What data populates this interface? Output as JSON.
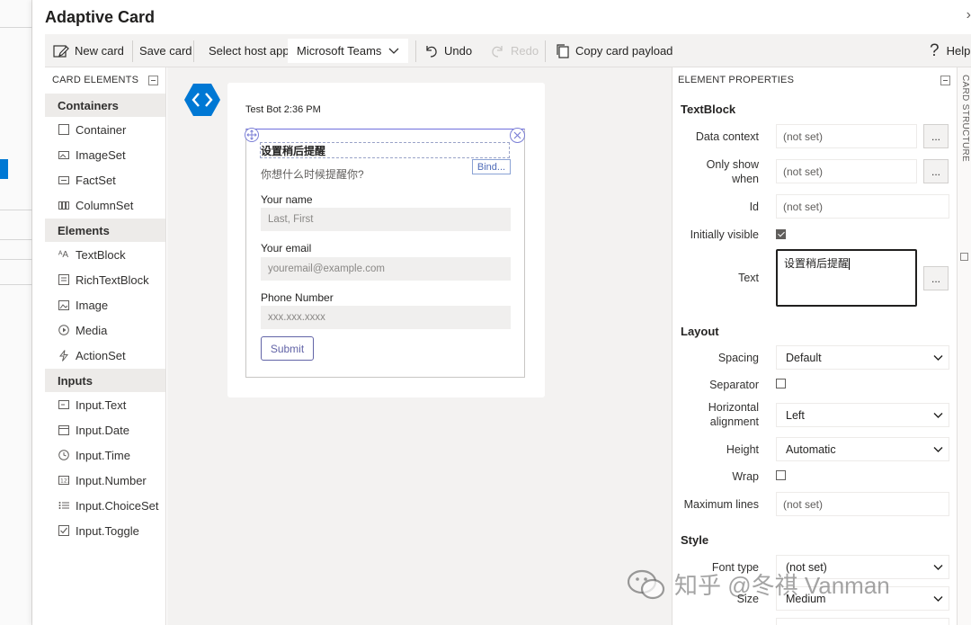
{
  "window": {
    "title": "Adaptive Card"
  },
  "toolbar": {
    "new_card": "New card",
    "save_card": "Save card",
    "host_label": "Select host app:",
    "host_value": "Microsoft Teams",
    "undo": "Undo",
    "redo": "Redo",
    "copy_payload": "Copy card payload",
    "help": "Help"
  },
  "card_elements": {
    "header": "CARD ELEMENTS",
    "categories": [
      {
        "name": "Containers",
        "items": [
          "Container",
          "ImageSet",
          "FactSet",
          "ColumnSet"
        ]
      },
      {
        "name": "Elements",
        "items": [
          "TextBlock",
          "RichTextBlock",
          "Image",
          "Media",
          "ActionSet"
        ]
      },
      {
        "name": "Inputs",
        "items": [
          "Input.Text",
          "Input.Date",
          "Input.Time",
          "Input.Number",
          "Input.ChoiceSet",
          "Input.Toggle"
        ]
      }
    ]
  },
  "canvas": {
    "sender": "Test Bot 2:36 PM",
    "card": {
      "title": "设置稍后提醒",
      "subtitle": "你想什么时候提醒你?",
      "bind_label": "Bind...",
      "fields": [
        {
          "label": "Your name",
          "placeholder": "Last, First"
        },
        {
          "label": "Your email",
          "placeholder": "youremail@example.com"
        },
        {
          "label": "Phone Number",
          "placeholder": "xxx.xxx.xxxx"
        }
      ],
      "submit": "Submit"
    }
  },
  "properties": {
    "header": "ELEMENT PROPERTIES",
    "element_type": "TextBlock",
    "data_context": {
      "label": "Data context",
      "value": "(not set)"
    },
    "only_show_when": {
      "label": "Only show when",
      "value": "(not set)"
    },
    "id": {
      "label": "Id",
      "value": "(not set)"
    },
    "initially_visible": {
      "label": "Initially visible",
      "checked": true
    },
    "text": {
      "label": "Text",
      "value": "设置稍后提醒"
    },
    "more_button": "...",
    "layout": {
      "title": "Layout",
      "spacing": {
        "label": "Spacing",
        "value": "Default"
      },
      "separator": {
        "label": "Separator",
        "checked": false
      },
      "horizontal_alignment": {
        "label": "Horizontal alignment",
        "value": "Left"
      },
      "height": {
        "label": "Height",
        "value": "Automatic"
      },
      "wrap": {
        "label": "Wrap",
        "checked": false
      },
      "max_lines": {
        "label": "Maximum lines",
        "value": "(not set)"
      }
    },
    "style": {
      "title": "Style",
      "font_type": {
        "label": "Font type",
        "value": "(not set)"
      },
      "size": {
        "label": "Size",
        "value": "Medium"
      }
    }
  },
  "structure_tab": {
    "label": "CARD STRUCTURE"
  },
  "watermark": "知乎 @冬祺 Vanman",
  "colors": {
    "accent": "#6264a7",
    "bot_blue": "#0078d4",
    "toolbar_bg": "#f3f2f1",
    "canvas_bg": "#f3f2f1"
  }
}
